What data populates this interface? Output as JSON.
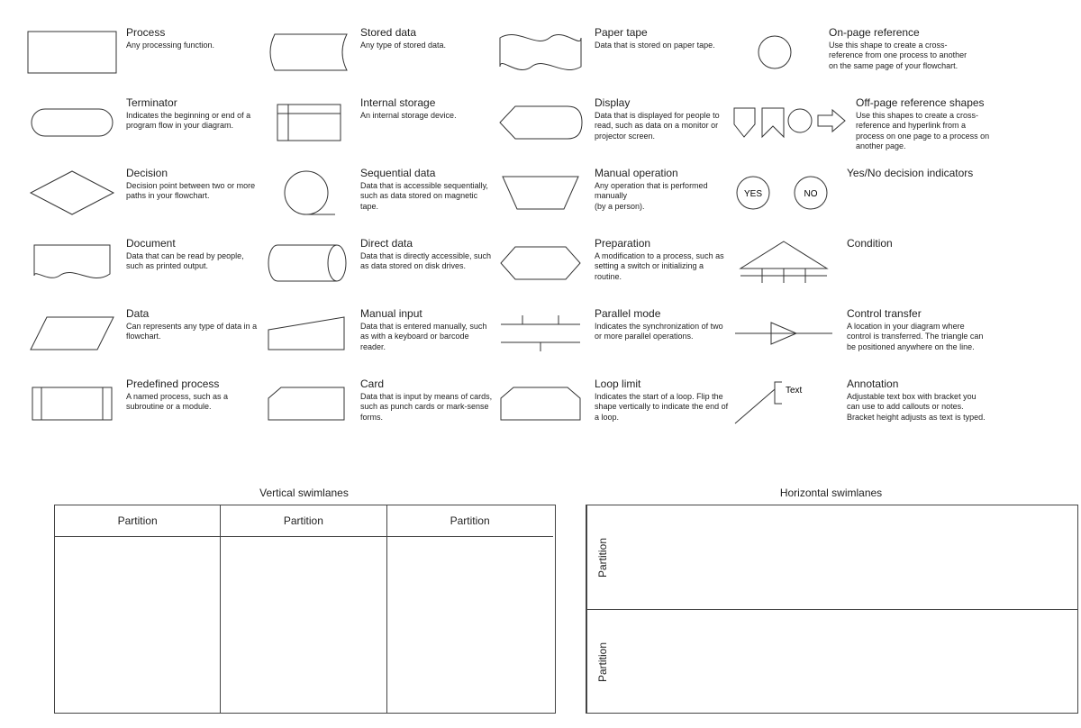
{
  "shapes": {
    "process": {
      "title": "Process",
      "desc": "Any processing function."
    },
    "terminator": {
      "title": "Terminator",
      "desc": "Indicates the beginning or end of a program flow in your diagram."
    },
    "decision": {
      "title": "Decision",
      "desc": "Decision point between two or more paths in your flowchart."
    },
    "document": {
      "title": "Document",
      "desc": "Data that can be read by people, such as printed output."
    },
    "data": {
      "title": "Data",
      "desc": "Can represents any type of data in a flowchart."
    },
    "predef_process": {
      "title": "Predefined process",
      "desc": "A named process, such as a subroutine or a module."
    },
    "stored_data": {
      "title": "Stored data",
      "desc": "Any type of stored data."
    },
    "internal_storage": {
      "title": "Internal storage",
      "desc": "An internal storage device."
    },
    "sequential_data": {
      "title": "Sequential data",
      "desc": "Data that is accessible sequentially, such as data stored on magnetic tape."
    },
    "direct_data": {
      "title": "Direct data",
      "desc": "Data that is directly accessible, such as data stored on disk drives."
    },
    "manual_input": {
      "title": "Manual input",
      "desc": "Data that is entered manually, such as with a keyboard or barcode reader."
    },
    "card": {
      "title": "Card",
      "desc": "Data that is input by means of cards, such as punch cards or mark-sense forms."
    },
    "paper_tape": {
      "title": "Paper tape",
      "desc": "Data that is stored on paper tape."
    },
    "display": {
      "title": "Display",
      "desc": "Data that is displayed for people to read, such as data on a monitor or projector screen."
    },
    "manual_operation": {
      "title": "Manual operation",
      "desc": "Any operation that is performed manually\n(by a person)."
    },
    "preparation": {
      "title": "Preparation",
      "desc": "A modification to a process, such as setting a switch or initializing a routine."
    },
    "parallel_mode": {
      "title": "Parallel mode",
      "desc": "Indicates the synchronization of two or more parallel operations."
    },
    "loop_limit": {
      "title": "Loop limit",
      "desc": "Indicates the start of a loop. Flip the shape vertically to indicate the end of a loop."
    },
    "on_page_ref": {
      "title": "On-page reference",
      "desc": "Use this shape to create a cross-reference from one process to another on the same page of your flowchart."
    },
    "off_page_ref": {
      "title": "Off-page reference shapes",
      "desc": "Use this shapes to create a cross-reference and hyperlink from a process on one page to a process on another page."
    },
    "yes_no": {
      "title": "Yes/No decision indicators",
      "desc": ""
    },
    "condition": {
      "title": "Condition",
      "desc": ""
    },
    "control_transfer": {
      "title": "Control transfer",
      "desc": "A location in your diagram where control is transferred. The triangle can be positioned anywhere on the line."
    },
    "annotation": {
      "title": "Annotation",
      "desc": "Adjustable text box with bracket you can use to add callouts or notes. Bracket height adjusts as text is typed."
    }
  },
  "yesno": {
    "yes": "YES",
    "no": "NO"
  },
  "annotation_label": "Text",
  "swimlanes": {
    "vertical_title": "Vertical swimlanes",
    "horizontal_title": "Horizontal swimlanes",
    "partition": "Partition"
  }
}
